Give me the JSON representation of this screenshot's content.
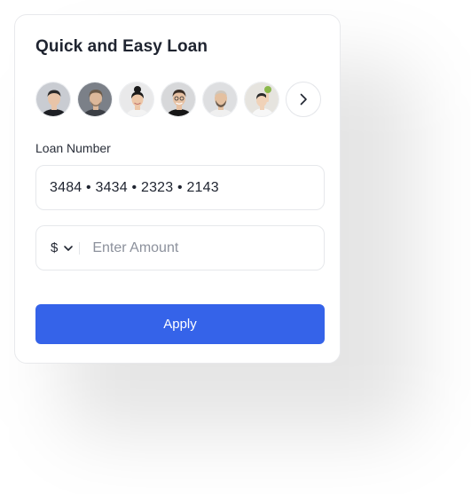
{
  "card": {
    "title": "Quick and Easy Loan"
  },
  "avatars": [
    {
      "name": "avatar-1",
      "bg": "#c9ccd2",
      "skin": "#e8c4a8",
      "hair": "#2b2a2a",
      "shirt": "#1d1f24"
    },
    {
      "name": "avatar-2",
      "bg": "#7b8088",
      "skin": "#dcb89a",
      "hair": "#6b5a48",
      "shirt": "#3b3f45"
    },
    {
      "name": "avatar-3",
      "bg": "#e9e9ea",
      "skin": "#edc7a8",
      "hair": "#1a1a1a",
      "shirt": "#f3f3f3"
    },
    {
      "name": "avatar-4",
      "bg": "#d7d8da",
      "skin": "#e7c1a3",
      "hair": "#3a2e26",
      "shirt": "#161616"
    },
    {
      "name": "avatar-5",
      "bg": "#dedfe1",
      "skin": "#e4c0a0",
      "hair": "#cfc7bd",
      "shirt": "#f0f0f0"
    },
    {
      "name": "avatar-6",
      "bg": "#e6e4df",
      "skin": "#f0d2b8",
      "hair": "#2a2a2a",
      "shirt": "#f7f7f7",
      "accent": "#8ab84a"
    }
  ],
  "loan": {
    "label": "Loan Number",
    "value": "3484 • 3434 • 2323 • 2143"
  },
  "amount": {
    "currency": "$",
    "placeholder": "Enter Amount"
  },
  "apply": {
    "label": "Apply"
  },
  "colors": {
    "primary": "#3563e9",
    "text": "#1f2430",
    "border": "#e6e8eb"
  },
  "icons": {
    "next": "chevron-right-icon",
    "dropdown": "chevron-down-icon"
  }
}
